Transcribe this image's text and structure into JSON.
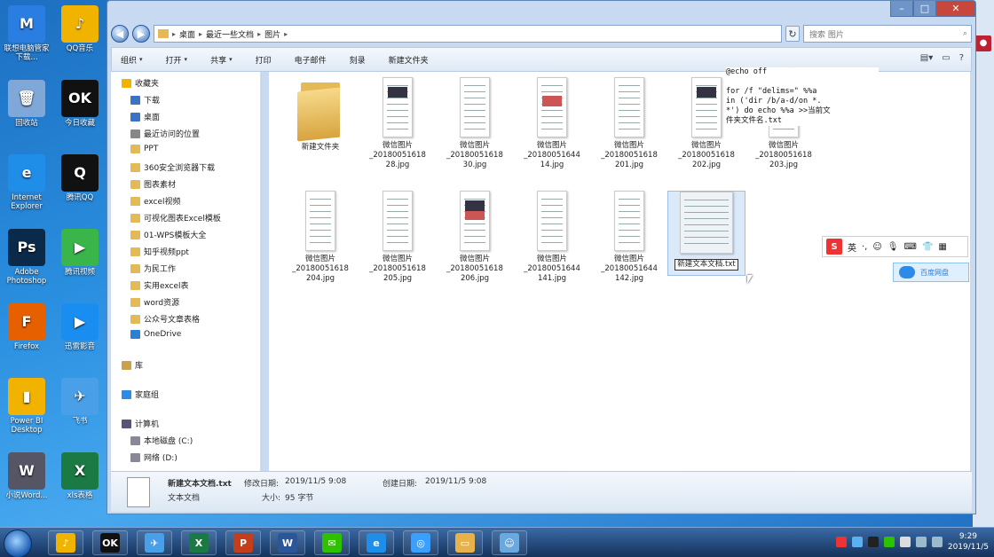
{
  "desktop_icons": [
    {
      "label": "联想电脑管家下载...",
      "glyph": "M",
      "color": "#2a7de1"
    },
    {
      "label": "QQ音乐",
      "glyph": "♪",
      "color": "#f0b400"
    },
    {
      "label": "回收站",
      "glyph": "🗑",
      "color": "#7fa7d8"
    },
    {
      "label": "今日收藏",
      "glyph": "OK",
      "color": "#111111"
    },
    {
      "label": "Internet Explorer",
      "glyph": "e",
      "color": "#1f8ee8"
    },
    {
      "label": "腾讯QQ",
      "glyph": "Q",
      "color": "#111111"
    },
    {
      "label": "Adobe Photoshop",
      "glyph": "Ps",
      "color": "#0b2a4a"
    },
    {
      "label": "腾讯视频",
      "glyph": "▶",
      "color": "#39b54a"
    },
    {
      "label": "Firefox",
      "glyph": "F",
      "color": "#e66000"
    },
    {
      "label": "迅雷影音",
      "glyph": "▶",
      "color": "#1a8ef0"
    },
    {
      "label": "Power BI Desktop",
      "glyph": "▮",
      "color": "#f2b300"
    },
    {
      "label": "飞书",
      "glyph": "✈",
      "color": "#4aa0e8"
    },
    {
      "label": "小说Word...",
      "glyph": "W",
      "color": "#556"
    },
    {
      "label": "xls表格",
      "glyph": "X",
      "color": "#1b7a43"
    }
  ],
  "window": {
    "breadcrumb": [
      "桌面",
      "最近一些文档",
      "图片"
    ],
    "search_placeholder": "搜索 图片",
    "toolbar": [
      {
        "label": "组织",
        "dropdown": true
      },
      {
        "label": "打开",
        "dropdown": true
      },
      {
        "label": "共享",
        "dropdown": true
      },
      {
        "label": "打印",
        "dropdown": false
      },
      {
        "label": "电子邮件",
        "dropdown": false
      },
      {
        "label": "刻录",
        "dropdown": false
      },
      {
        "label": "新建文件夹",
        "dropdown": false
      }
    ]
  },
  "nav_pane": [
    {
      "label": "收藏夹",
      "icon": "star",
      "indent": 0
    },
    {
      "label": "下载",
      "icon": "download",
      "indent": 1
    },
    {
      "label": "桌面",
      "icon": "desktop",
      "indent": 1
    },
    {
      "label": "最近访问的位置",
      "icon": "recent",
      "indent": 1
    },
    {
      "label": "PPT",
      "icon": "folder",
      "indent": 1
    },
    {
      "label": "360安全浏览器下载",
      "icon": "folder",
      "indent": 1
    },
    {
      "label": "图表素材",
      "icon": "folder",
      "indent": 1
    },
    {
      "label": "excel视频",
      "icon": "folder",
      "indent": 1
    },
    {
      "label": "可视化图表Excel模板",
      "icon": "folder",
      "indent": 1
    },
    {
      "label": "01-WPS模板大全",
      "icon": "folder",
      "indent": 1
    },
    {
      "label": "知乎视频ppt",
      "icon": "folder",
      "indent": 1
    },
    {
      "label": "为民工作",
      "icon": "folder",
      "indent": 1
    },
    {
      "label": "实用excel表",
      "icon": "folder",
      "indent": 1
    },
    {
      "label": "word资源",
      "icon": "folder",
      "indent": 1
    },
    {
      "label": "公众号文章表格",
      "icon": "folder",
      "indent": 1
    },
    {
      "label": "OneDrive",
      "icon": "cloud",
      "indent": 1
    },
    {
      "label": "库",
      "icon": "library",
      "indent": 0
    },
    {
      "label": "家庭组",
      "icon": "homegroup",
      "indent": 0
    },
    {
      "label": "计算机",
      "icon": "computer",
      "indent": 0
    },
    {
      "label": "本地磁盘 (C:)",
      "icon": "drive",
      "indent": 1
    },
    {
      "label": "网络 (D:)",
      "icon": "drive",
      "indent": 1
    }
  ],
  "files": [
    {
      "name": "新建文件夹",
      "type": "folder"
    },
    {
      "name": "微信图片_20180051618 28.jpg",
      "type": "image"
    },
    {
      "name": "微信图片_20180051618 30.jpg",
      "type": "image"
    },
    {
      "name": "微信图片_20180051644 14.jpg",
      "type": "image"
    },
    {
      "name": "微信图片_20180051618 201.jpg",
      "type": "image"
    },
    {
      "name": "微信图片_20180051618 202.jpg",
      "type": "image"
    },
    {
      "name": "微信图片_20180051618 203.jpg",
      "type": "image"
    },
    {
      "name": "微信图片_20180051618 204.jpg",
      "type": "image"
    },
    {
      "name": "微信图片_20180051618 205.jpg",
      "type": "image"
    },
    {
      "name": "微信图片_20180051618 206.jpg",
      "type": "image"
    },
    {
      "name": "微信图片_20180051644 141.jpg",
      "type": "image"
    },
    {
      "name": "微信图片_20180051644 142.jpg",
      "type": "image"
    },
    {
      "name": "新建文本文档.txt",
      "type": "text",
      "selected": true,
      "renaming": true
    }
  ],
  "note_text": "@echo off\n\nfor /f \"delims=\" %%a\nin ('dir /b/a-d/on *.\n*') do echo %%a >>当前文\n件夹文件名.txt",
  "ime": {
    "logo": "S",
    "mode": "英"
  },
  "cloud_widget": {
    "label": "百度网盘"
  },
  "details": {
    "filename": "新建文本文档.txt",
    "modified_label": "修改日期:",
    "modified": "2019/11/5 9:08",
    "created_label": "创建日期:",
    "created": "2019/11/5 9:08",
    "type": "文本文档",
    "size_label": "大小:",
    "size": "95 字节"
  },
  "taskbar_apps": [
    {
      "label": "♪",
      "color": "#f0b400"
    },
    {
      "label": "OK",
      "color": "#111111"
    },
    {
      "label": "✈",
      "color": "#4aa0e8"
    },
    {
      "label": "X",
      "color": "#1b7a43"
    },
    {
      "label": "P",
      "color": "#c43e1c"
    },
    {
      "label": "W",
      "color": "#2b579a"
    },
    {
      "label": "✉",
      "color": "#2dc100"
    },
    {
      "label": "e",
      "color": "#1f8ee8"
    },
    {
      "label": "◎",
      "color": "#3aa0ff"
    },
    {
      "label": "▭",
      "color": "#e7b24a"
    },
    {
      "label": "☺",
      "color": "#6aa8e0"
    }
  ],
  "clock": {
    "time": "9:29",
    "date": "2019/11/5"
  }
}
